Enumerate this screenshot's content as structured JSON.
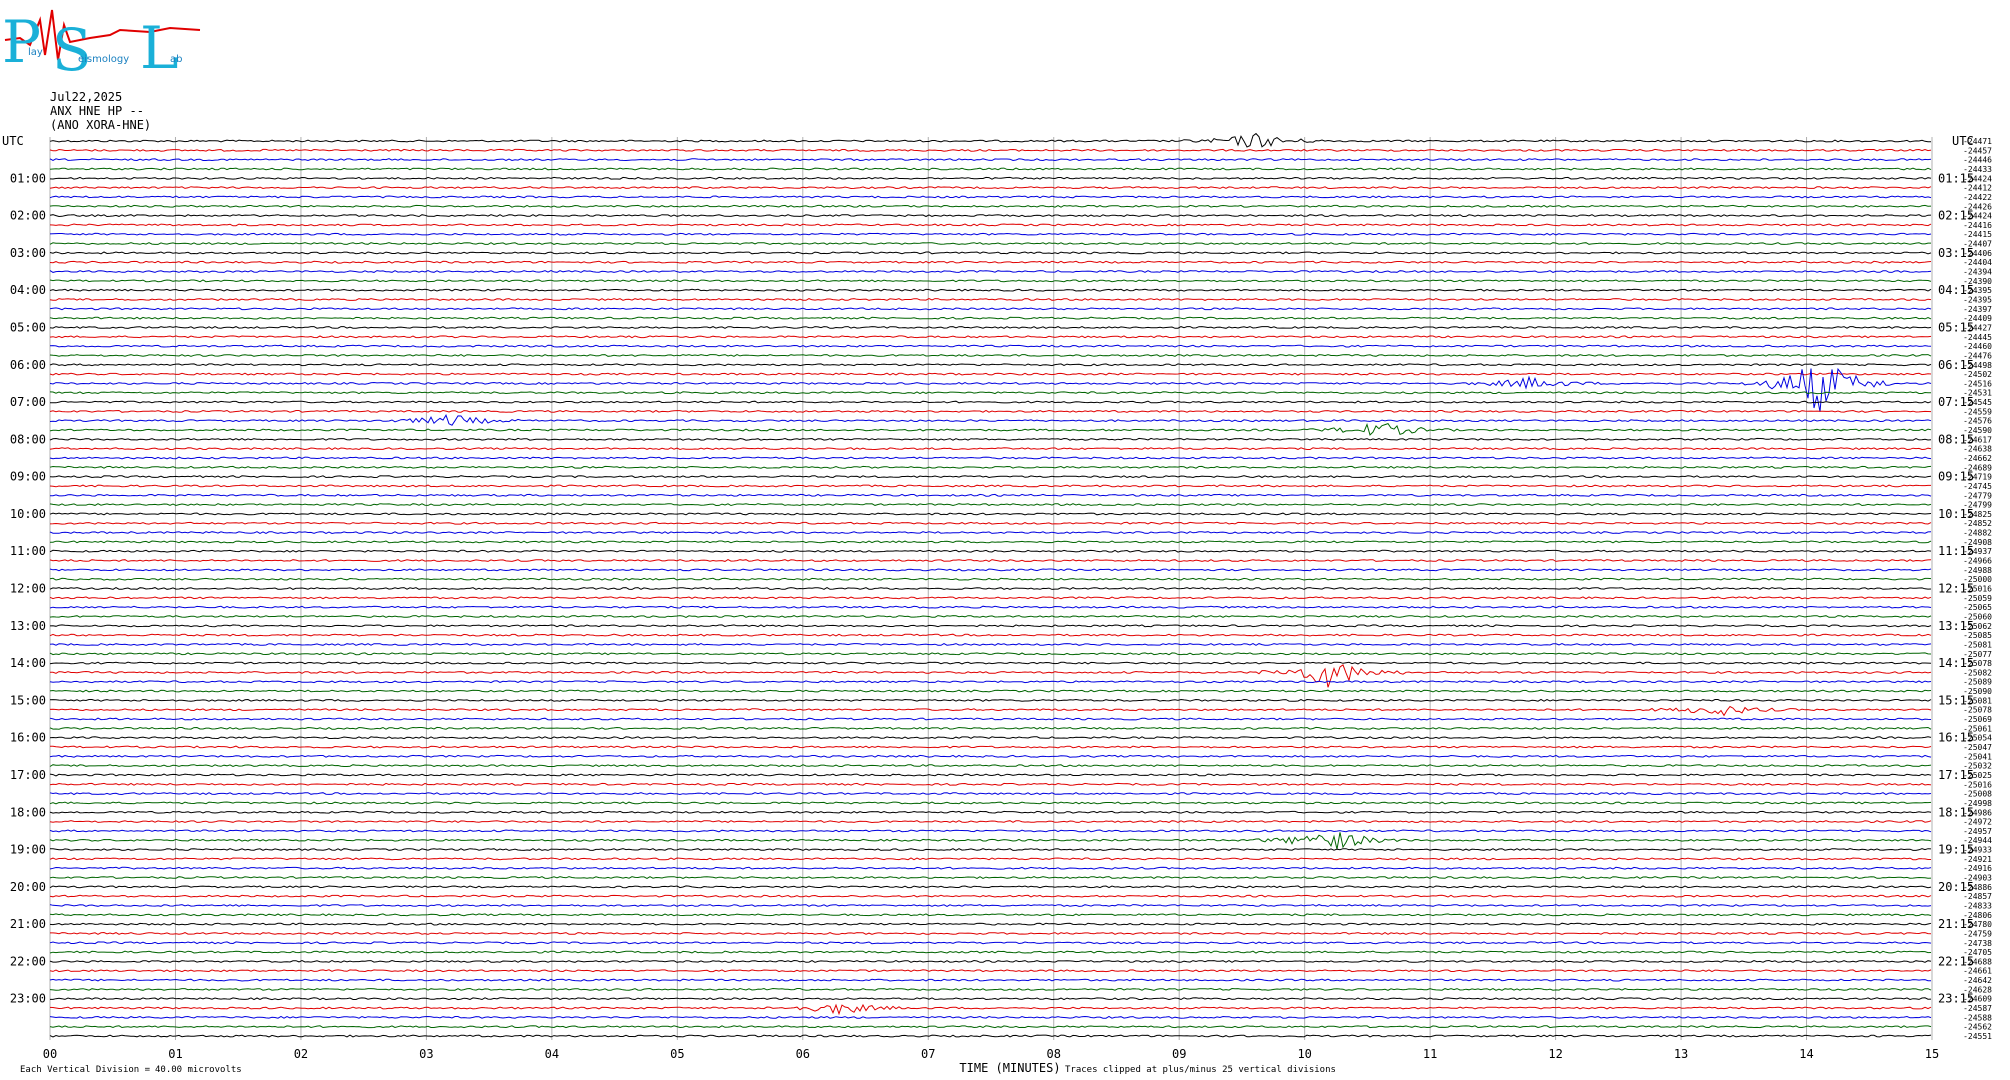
{
  "logo": {
    "letters": "PSL",
    "words": [
      "lay",
      "eismology",
      "ab"
    ]
  },
  "header": {
    "date": "Jul22,2025",
    "station": "ANX HNE HP --",
    "channel": "(ANO XORA-HNE)"
  },
  "left_axis": {
    "label": "UTC",
    "hours": [
      "01:00",
      "02:00",
      "03:00",
      "04:00",
      "05:00",
      "06:00",
      "07:00",
      "08:00",
      "09:00",
      "10:00",
      "11:00",
      "12:00",
      "13:00",
      "14:00",
      "15:00",
      "16:00",
      "17:00",
      "18:00",
      "19:00",
      "20:00",
      "21:00",
      "22:00",
      "23:00"
    ]
  },
  "right_axis": {
    "label": "UTC",
    "hours": [
      "01:15",
      "02:15",
      "03:15",
      "04:15",
      "05:15",
      "06:15",
      "07:15",
      "08:15",
      "09:15",
      "10:15",
      "11:15",
      "12:15",
      "13:15",
      "14:15",
      "15:15",
      "16:15",
      "17:15",
      "18:15",
      "19:15",
      "20:15",
      "21:15",
      "22:15",
      "23:15"
    ]
  },
  "offsets": [
    "-24471",
    "-24457",
    "-24446",
    "-24433",
    "-24424",
    "-24412",
    "-24422",
    "-24426",
    "-24424",
    "-24416",
    "-24415",
    "-24407",
    "-24406",
    "-24404",
    "-24394",
    "-24390",
    "-24395",
    "-24395",
    "-24397",
    "-24409",
    "-24427",
    "-24445",
    "-24460",
    "-24476",
    "-24498",
    "-24502",
    "-24516",
    "-24531",
    "-24545",
    "-24559",
    "-24576",
    "-24590",
    "-24617",
    "-24638",
    "-24662",
    "-24689",
    "-24719",
    "-24745",
    "-24779",
    "-24799",
    "-24825",
    "-24852",
    "-24882",
    "-24908",
    "-24937",
    "-24966",
    "-24988",
    "-25000",
    "-25016",
    "-25059",
    "-25065",
    "-25060",
    "-25062",
    "-25085",
    "-25081",
    "-25077",
    "-25078",
    "-25082",
    "-25089",
    "-25090",
    "-25081",
    "-25078",
    "-25069",
    "-25061",
    "-25054",
    "-25047",
    "-25041",
    "-25032",
    "-25025",
    "-25016",
    "-25008",
    "-24998",
    "-24986",
    "-24972",
    "-24957",
    "-24944",
    "-24933",
    "-24921",
    "-24916",
    "-24903",
    "-24886",
    "-24857",
    "-24833",
    "-24806",
    "-24780",
    "-24759",
    "-24738",
    "-24705",
    "-24688",
    "-24661",
    "-24642",
    "-24628",
    "-24609",
    "-24587",
    "-24588",
    "-24562",
    "-24551"
  ],
  "x_axis": {
    "ticks": [
      "00",
      "01",
      "02",
      "03",
      "04",
      "05",
      "06",
      "07",
      "08",
      "09",
      "10",
      "11",
      "12",
      "13",
      "14",
      "15"
    ],
    "label": "TIME (MINUTES)"
  },
  "footer": {
    "left": "Each Vertical Division =",
    "scale": "40.00 microvolts",
    "clip_note": "Traces clipped at plus/minus 25 vertical divisions"
  },
  "trace_colors": [
    "#000000",
    "#e00000",
    "#0000e0",
    "#006400"
  ],
  "events": [
    {
      "row": 0,
      "minute": 9.6,
      "amp": 8,
      "color": 0
    },
    {
      "row": 26,
      "minute": 14.1,
      "amp": 30,
      "color": 2
    },
    {
      "row": 26,
      "minute": 11.8,
      "amp": 6,
      "color": 3
    },
    {
      "row": 57,
      "minute": 10.2,
      "amp": 16,
      "color": 1
    },
    {
      "row": 75,
      "minute": 10.2,
      "amp": 12,
      "color": 3
    },
    {
      "row": 30,
      "minute": 3.2,
      "amp": 6,
      "color": 2
    },
    {
      "row": 31,
      "minute": 10.6,
      "amp": 8,
      "color": 3
    },
    {
      "row": 61,
      "minute": 13.3,
      "amp": 6,
      "color": 1
    },
    {
      "row": 93,
      "minute": 6.3,
      "amp": 6,
      "color": 3
    }
  ]
}
